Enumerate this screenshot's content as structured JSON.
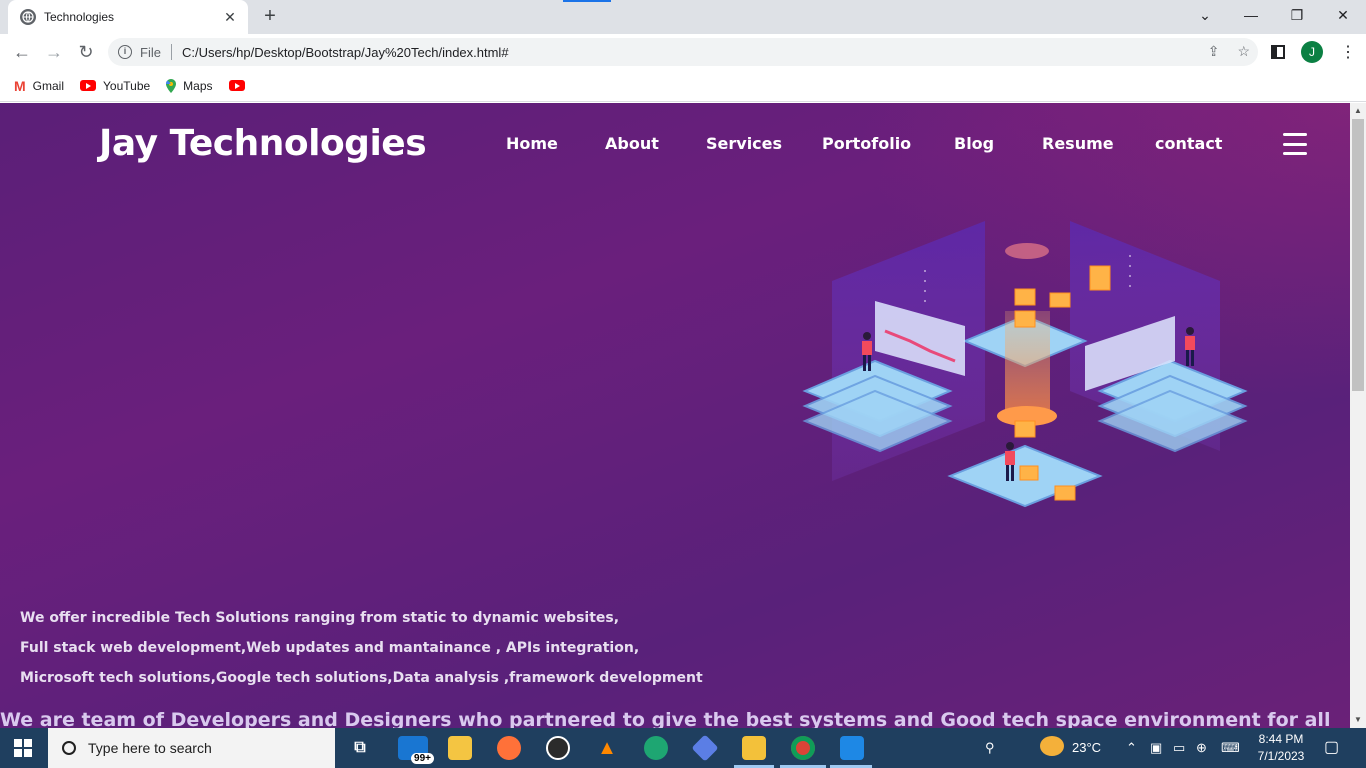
{
  "browser": {
    "tab_title": "Technologies",
    "omnibox_scheme": "File",
    "url": "C:/Users/hp/Desktop/Bootstrap/Jay%20Tech/index.html#",
    "profile_initial": "J",
    "bookmarks": [
      {
        "label": "Gmail",
        "icon": "gmail-icon"
      },
      {
        "label": "YouTube",
        "icon": "youtube-icon"
      },
      {
        "label": "Maps",
        "icon": "maps-icon"
      },
      {
        "label": "",
        "icon": "youtube-icon"
      }
    ]
  },
  "page": {
    "brand": "Jay Technologies",
    "nav": [
      "Home",
      "About",
      "Services",
      "Portofolio",
      "Blog",
      "Resume",
      "contact"
    ],
    "intro_lines": [
      "We offer incredible Tech Solutions ranging from static to dynamic websites,",
      "Full stack web development,Web updates and mantainance , APIs integration,",
      "Microsoft tech solutions,Google tech solutions,Data analysis ,framework development"
    ],
    "tagline": "We are team of Developers and Designers who partnered to give the best systems and Good tech space environment for all",
    "colors": {
      "background": "#5f2079",
      "accent": "#f29b3c"
    }
  },
  "taskbar": {
    "search_placeholder": "Type here to search",
    "mail_badge": "99+",
    "weather": "23°C",
    "time": "8:44 PM",
    "date": "7/1/2023"
  }
}
